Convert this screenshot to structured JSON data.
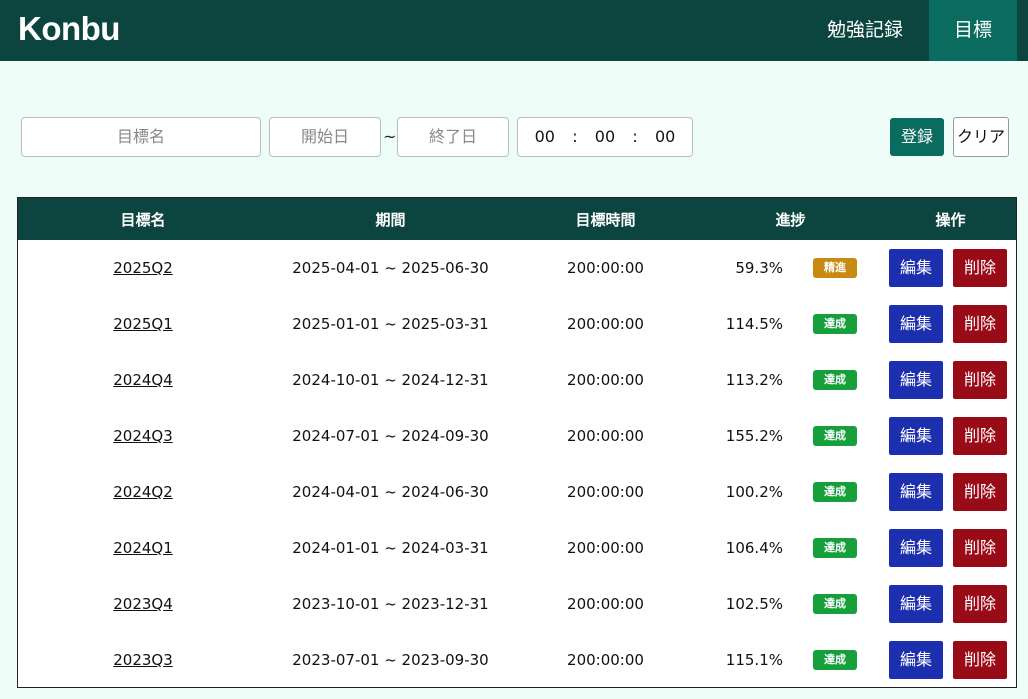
{
  "header": {
    "logo": "Konbu",
    "nav": [
      {
        "label": "勉強記録"
      },
      {
        "label": "目標"
      }
    ]
  },
  "form": {
    "name_placeholder": "目標名",
    "start_placeholder": "開始日",
    "end_placeholder": "終了日",
    "range_sep": "~",
    "time": {
      "hh": "00",
      "sep1": ":",
      "mm": "00",
      "sep2": ":",
      "ss": "00"
    },
    "register_label": "登録",
    "clear_label": "クリア"
  },
  "table": {
    "headers": {
      "name": "目標名",
      "period": "期間",
      "hours": "目標時間",
      "progress": "進捗",
      "ops": "操作"
    },
    "edit_label": "編集",
    "delete_label": "削除",
    "rows": [
      {
        "name": "2025Q2",
        "period": "2025-04-01 ~ 2025-06-30",
        "hours": "200:00:00",
        "progress": "59.3%",
        "status": "精進",
        "status_color": "#c88a10"
      },
      {
        "name": "2025Q1",
        "period": "2025-01-01 ~ 2025-03-31",
        "hours": "200:00:00",
        "progress": "114.5%",
        "status": "達成",
        "status_color": "#15a03c"
      },
      {
        "name": "2024Q4",
        "period": "2024-10-01 ~ 2024-12-31",
        "hours": "200:00:00",
        "progress": "113.2%",
        "status": "達成",
        "status_color": "#15a03c"
      },
      {
        "name": "2024Q3",
        "period": "2024-07-01 ~ 2024-09-30",
        "hours": "200:00:00",
        "progress": "155.2%",
        "status": "達成",
        "status_color": "#15a03c"
      },
      {
        "name": "2024Q2",
        "period": "2024-04-01 ~ 2024-06-30",
        "hours": "200:00:00",
        "progress": "100.2%",
        "status": "達成",
        "status_color": "#15a03c"
      },
      {
        "name": "2024Q1",
        "period": "2024-01-01 ~ 2024-03-31",
        "hours": "200:00:00",
        "progress": "106.4%",
        "status": "達成",
        "status_color": "#15a03c"
      },
      {
        "name": "2023Q4",
        "period": "2023-10-01 ~ 2023-12-31",
        "hours": "200:00:00",
        "progress": "102.5%",
        "status": "達成",
        "status_color": "#15a03c"
      },
      {
        "name": "2023Q3",
        "period": "2023-07-01 ~ 2023-09-30",
        "hours": "200:00:00",
        "progress": "115.1%",
        "status": "達成",
        "status_color": "#15a03c"
      }
    ]
  },
  "colors": {
    "header_bg": "#0c4540",
    "active_tab": "#0a6b5f",
    "page_bg": "#effdf8",
    "edit_button": "#1c2fae",
    "delete_button": "#990b16"
  }
}
